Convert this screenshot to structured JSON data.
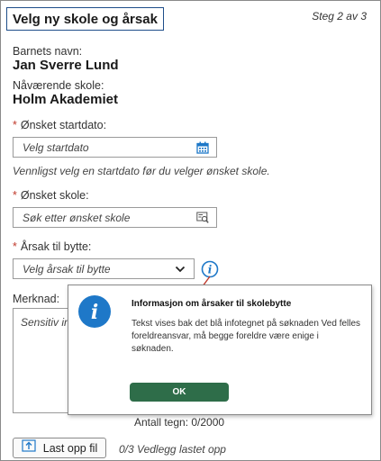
{
  "header": {
    "title": "Velg ny skole og årsak",
    "step": "Steg 2 av 3"
  },
  "child": {
    "label": "Barnets navn:",
    "value": "Jan Sverre Lund"
  },
  "current_school": {
    "label": "Nåværende skole:",
    "value": "Holm Akademiet"
  },
  "start_date": {
    "label": "Ønsket startdato:",
    "placeholder": "Velg startdato",
    "hint": "Vennligst velg en startdato før du velger ønsket skole.",
    "icon": "calendar-icon"
  },
  "school": {
    "label": "Ønsket skole:",
    "placeholder": "Søk etter ønsket skole",
    "icon": "search-list-icon"
  },
  "reason": {
    "label": "Årsak til bytte:",
    "placeholder": "Velg årsak til bytte",
    "icon": "chevron-down-icon"
  },
  "remark": {
    "label": "Merknad:",
    "placeholder": "Sensitiv info",
    "counter": "Antall tegn: 0/2000"
  },
  "upload": {
    "button_label": "Last opp fil",
    "status": "0/3 Vedlegg lastet opp",
    "icon": "upload-icon"
  },
  "required_marker": "*",
  "dialog": {
    "title": "Informasjon om årsaker til skolebytte",
    "text": "Tekst vises bak det blå infotegnet på søknaden Ved felles foreldreansvar, må begge foreldre være enige i søknaden.",
    "ok_label": "OK",
    "icon_glyph": "i",
    "info_glyph": "i"
  },
  "colors": {
    "accent": "#1f4e8a",
    "info_blue": "#1e78c8",
    "ok_green": "#2e6d49",
    "required": "#c0392b",
    "arrow": "#c0392b"
  }
}
